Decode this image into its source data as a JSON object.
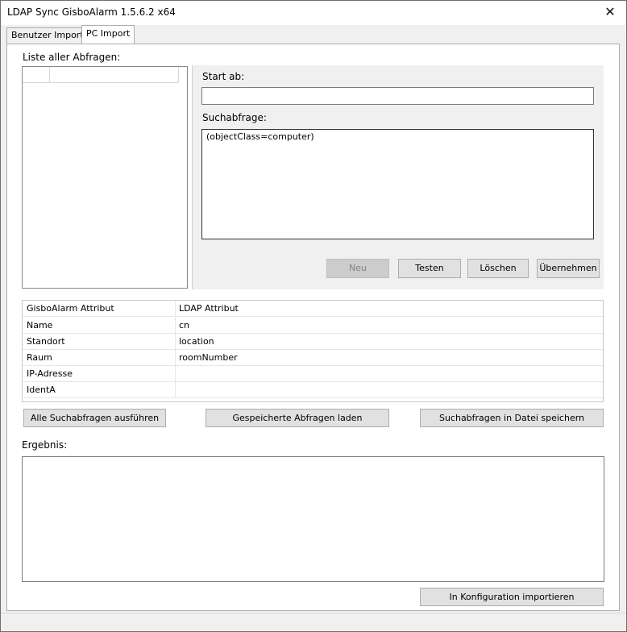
{
  "window": {
    "title": "LDAP Sync GisboAlarm 1.5.6.2 x64",
    "close_glyph": "✕"
  },
  "tabs": [
    {
      "label": "Benutzer Import",
      "active": false
    },
    {
      "label": "PC Import",
      "active": true
    }
  ],
  "query_list": {
    "label": "Liste aller Abfragen:"
  },
  "editor": {
    "start_label": "Start ab:",
    "start_value": "",
    "query_label": "Suchabfrage:",
    "query_value": "(objectClass=computer)",
    "buttons": {
      "new": "Neu",
      "test": "Testen",
      "delete": "Löschen",
      "apply": "Übernehmen"
    }
  },
  "mapping_table": {
    "headers": [
      "GisboAlarm Attribut",
      "LDAP Attribut"
    ],
    "rows": [
      [
        "Name",
        "cn"
      ],
      [
        "Standort",
        "location"
      ],
      [
        "Raum",
        "roomNumber"
      ],
      [
        "IP-Adresse",
        ""
      ],
      [
        "IdentA",
        ""
      ]
    ]
  },
  "actions": {
    "run_all": "Alle Suchabfragen ausführen",
    "load_saved": "Gespeicherte Abfragen laden",
    "save_to_file": "Suchabfragen in Datei speichern"
  },
  "result": {
    "label": "Ergebnis:",
    "value": ""
  },
  "import_button": "In Konfiguration importieren"
}
